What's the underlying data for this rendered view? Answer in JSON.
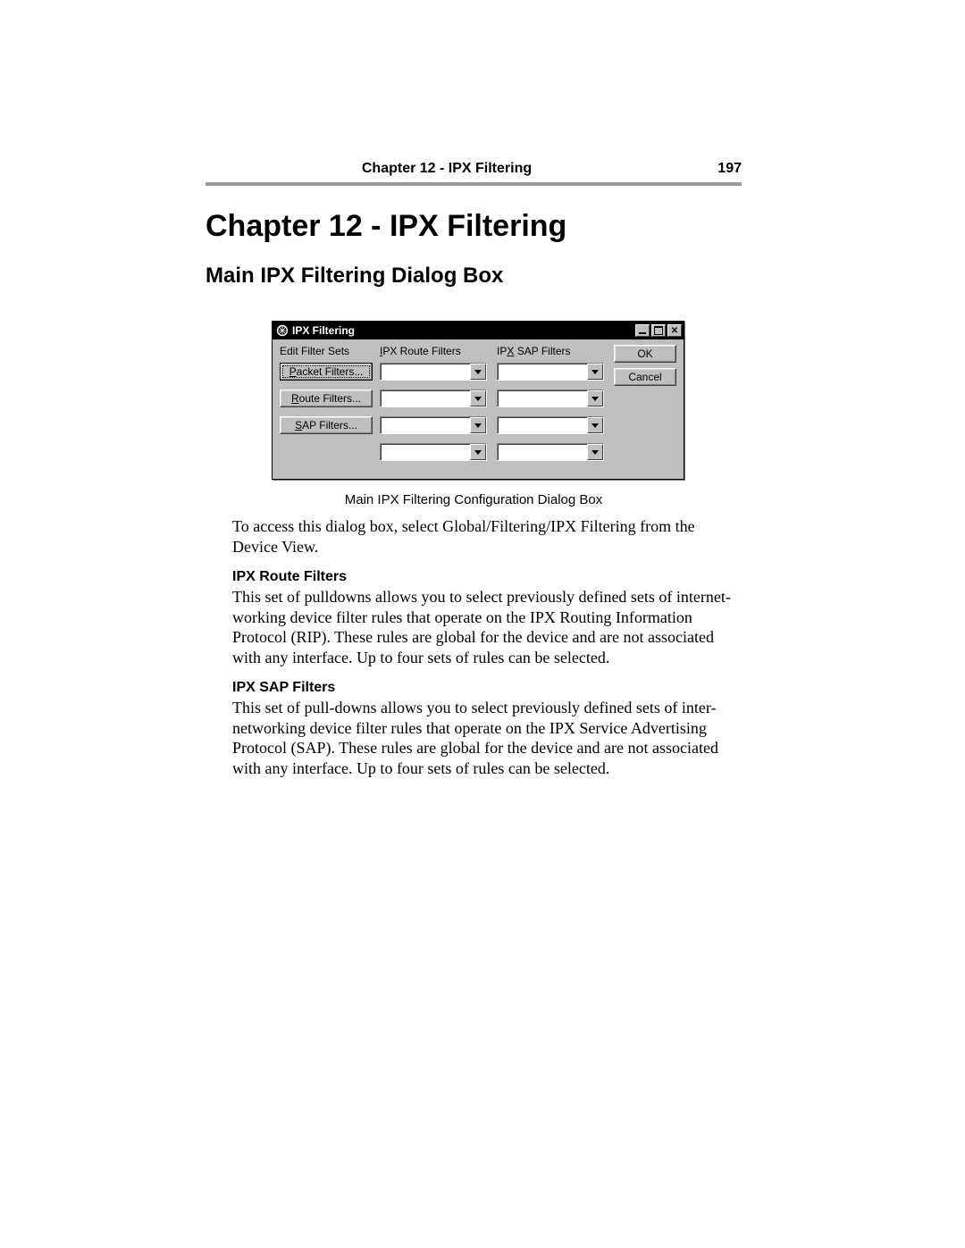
{
  "header": {
    "title": "Chapter 12 - IPX Filtering",
    "page_number": "197"
  },
  "chapter_title": "Chapter 12 - IPX Filtering",
  "section_title": "Main IPX Filtering Dialog Box",
  "dialog": {
    "title": "IPX Filtering",
    "columns": {
      "edit_label": "Edit Filter Sets",
      "route_label_pre": "I",
      "route_label_post": "PX Route Filters",
      "sap_label_pre": "IP",
      "sap_label_mid": "X",
      "sap_label_post": " SAP Filters"
    },
    "left_buttons": {
      "packet_pre": "P",
      "packet_post": "acket Filters...",
      "route_pre": "R",
      "route_post": "oute Filters...",
      "sap_pre": "S",
      "sap_post": "AP Filters..."
    },
    "route_combo": [
      "",
      "",
      "",
      ""
    ],
    "sap_combo": [
      "",
      "",
      "",
      ""
    ],
    "actions": {
      "ok": "OK",
      "cancel": "Cancel"
    }
  },
  "figure_caption": "Main IPX Filtering Configuration Dialog Box",
  "intro_paragraph": "To access this dialog box, select Global/Filtering/IPX Filtering from the Device View.",
  "sections": [
    {
      "heading": "IPX Route Filters",
      "body": "This set of pulldowns allows you to select previously defined sets of internet-working device filter rules that operate on the IPX Routing Information Protocol (RIP). These rules are global for the device and are not associated with any interface. Up to four sets of rules can be selected."
    },
    {
      "heading": "IPX SAP Filters",
      "body": "This set of pull-downs allows you to select previously defined sets of inter-networking device filter rules that operate on the IPX Service Advertising Protocol (SAP). These rules are global for the device and are not associated with any interface. Up to four sets of rules can be selected."
    }
  ]
}
